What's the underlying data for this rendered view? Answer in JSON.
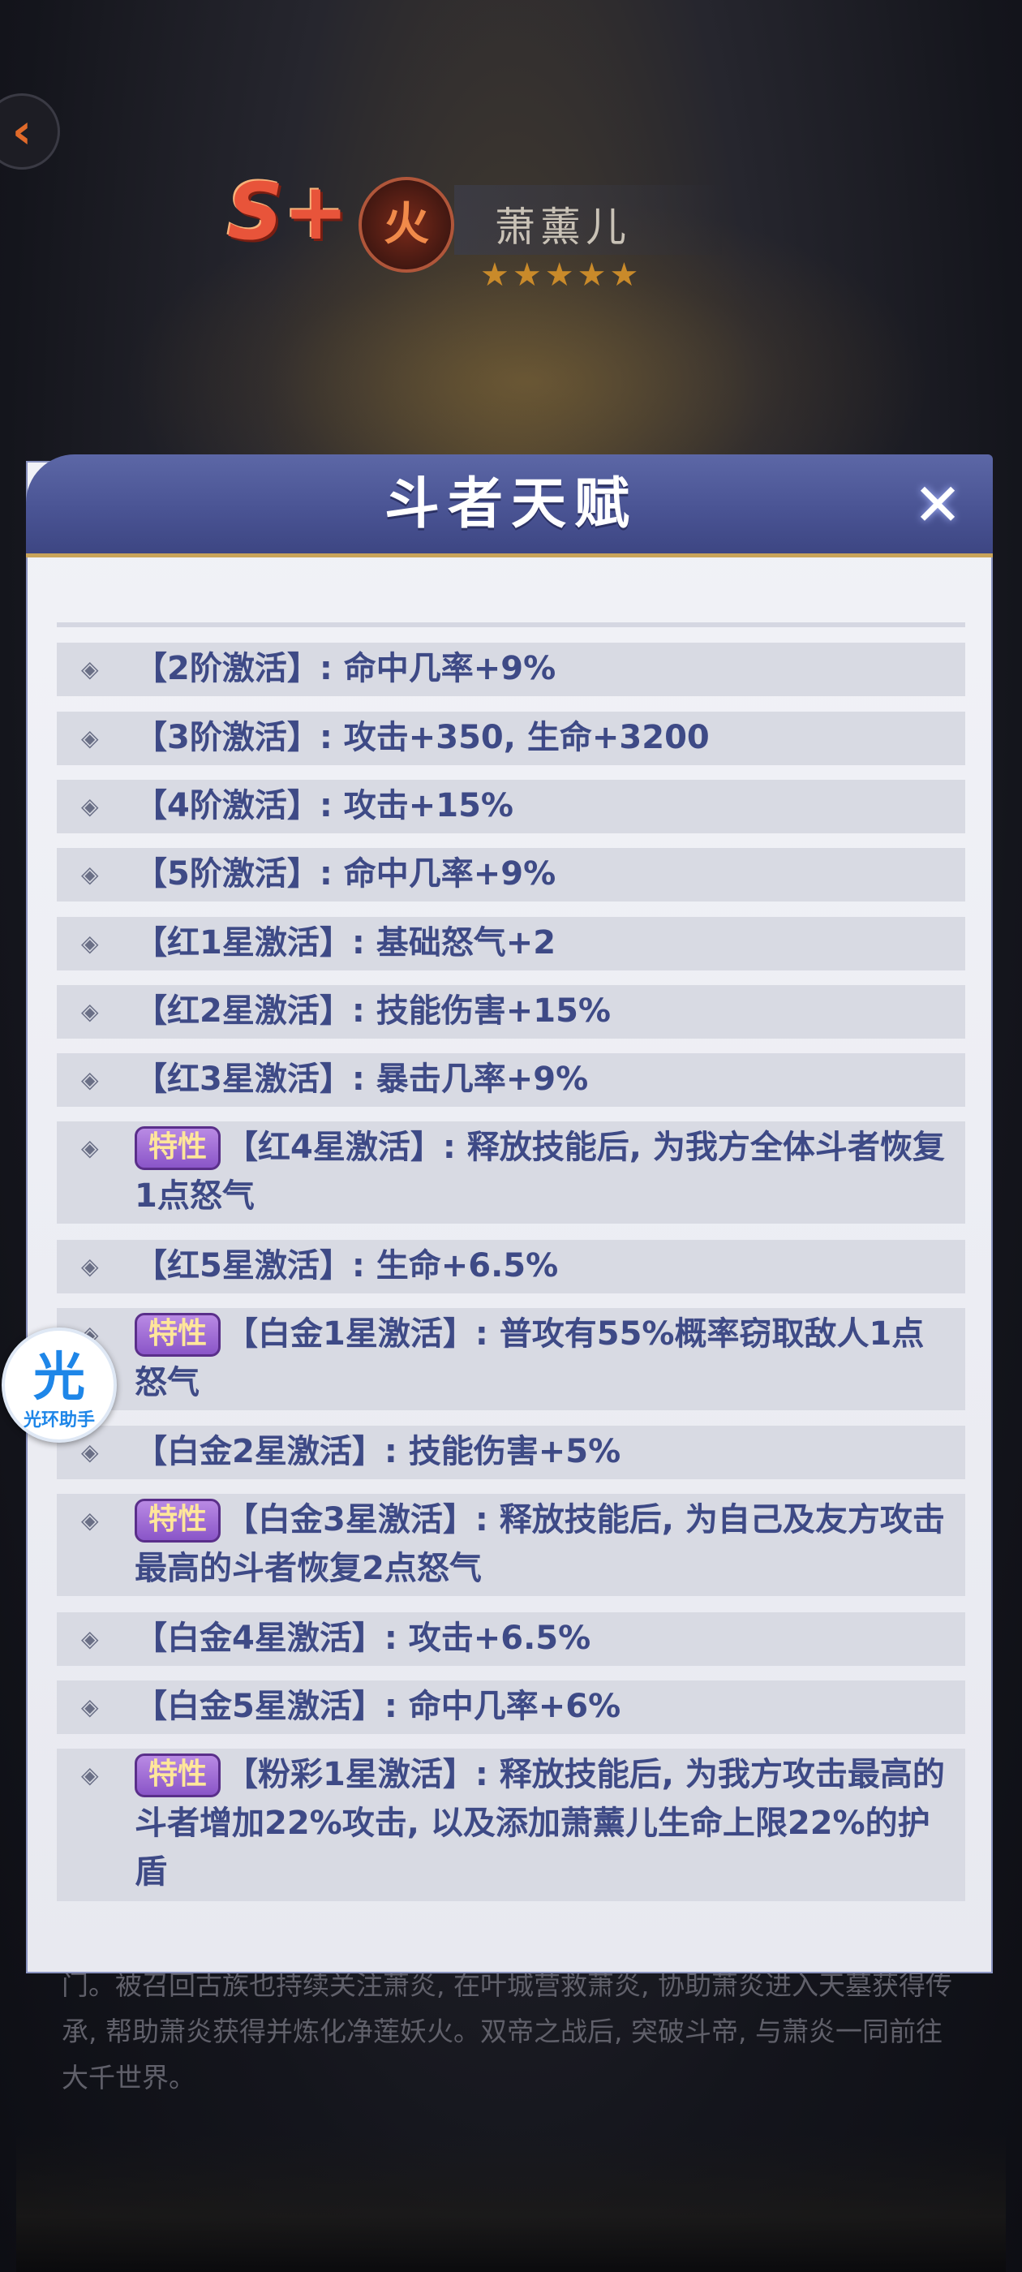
{
  "hero": {
    "grade": "S+",
    "element": "火",
    "name": "萧薰儿",
    "stars": "★★★★★"
  },
  "panel": {
    "title": "斗者天赋",
    "close_icon": "close-icon",
    "trait_label": "特性",
    "rows": [
      {
        "text": "【2阶激活】: 命中几率+9%"
      },
      {
        "text": "【3阶激活】: 攻击+350, 生命+3200"
      },
      {
        "text": "【4阶激活】: 攻击+15%"
      },
      {
        "text": "【5阶激活】: 命中几率+9%"
      },
      {
        "text": "【红1星激活】: 基础怒气+2"
      },
      {
        "text": "【红2星激活】: 技能伤害+15%"
      },
      {
        "text": "【红3星激活】: 暴击几率+9%"
      },
      {
        "text": "【红4星激活】: 释放技能后, 为我方全体斗者恢复1点怒气",
        "trait": true
      },
      {
        "text": "【红5星激活】: 生命+6.5%"
      },
      {
        "text": "【白金1星激活】: 普攻有55%概率窃取敌人1点怒气",
        "trait": true
      },
      {
        "text": "【白金2星激活】: 技能伤害+5%"
      },
      {
        "text": "【白金3星激活】: 释放技能后, 为自己及友方攻击最高的斗者恢复2点怒气",
        "trait": true
      },
      {
        "text": "【白金4星激活】: 攻击+6.5%"
      },
      {
        "text": "【白金5星激活】: 命中几率+6%"
      },
      {
        "text": "【粉彩1星激活】: 释放技能后, 为我方攻击最高的斗者增加22%攻击, 以及添加萧薰儿生命上限22%的护盾",
        "trait": true
      }
    ]
  },
  "lore": {
    "text": "门。被召回古族也持续关注萧炎, 在叶城营救萧炎, 协助萧炎进入天墓获得传承, 帮助萧炎获得并炼化净莲妖火。双帝之战后, 突破斗帝, 与萧炎一同前往大千世界。"
  },
  "side_badge": {
    "glyph": "光",
    "label": "光环助手"
  },
  "colors": {
    "header": "#4a5494",
    "row_bg": "#d8dae3",
    "text": "#3e4a86",
    "trait_badge": "#8a55c8"
  }
}
